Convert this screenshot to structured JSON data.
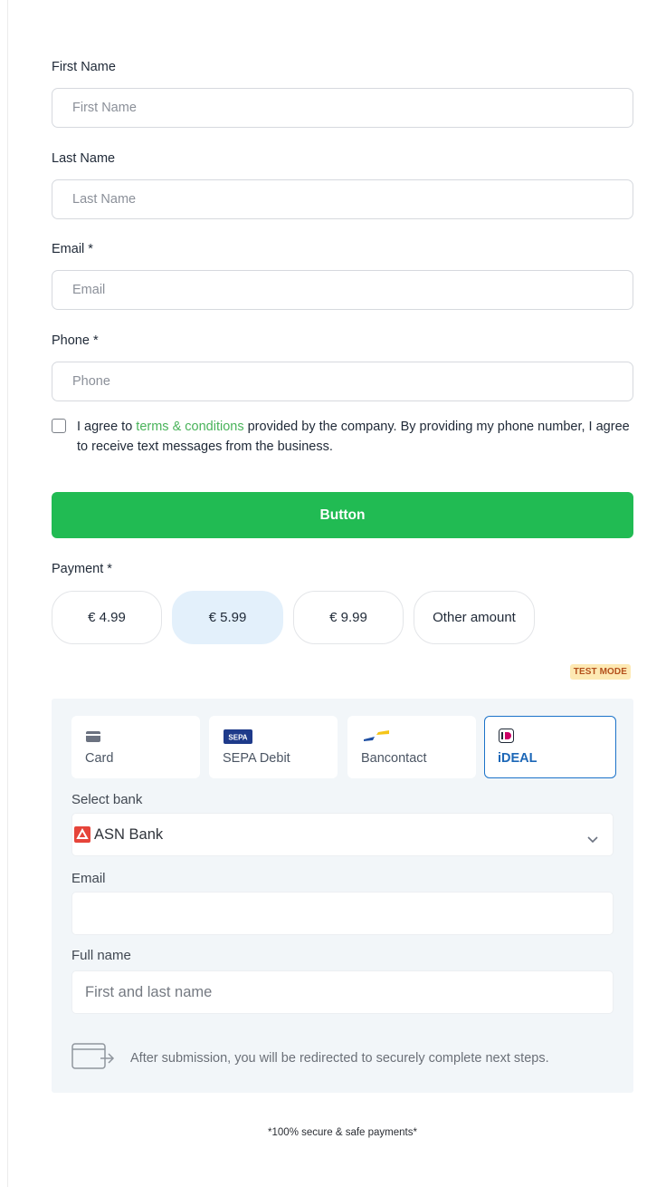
{
  "form": {
    "first_name": {
      "label": "First Name",
      "placeholder": "First Name"
    },
    "last_name": {
      "label": "Last Name",
      "placeholder": "Last Name"
    },
    "email": {
      "label": "Email *",
      "placeholder": "Email"
    },
    "phone": {
      "label": "Phone *",
      "placeholder": "Phone"
    },
    "agree": {
      "prefix": "I agree to ",
      "link": "terms & conditions",
      "suffix": " provided by the company. By providing my phone number, I agree to receive text messages from the business.",
      "checked": false
    },
    "submit_label": "Button"
  },
  "payment": {
    "label": "Payment *",
    "amounts": [
      "€ 4.99",
      "€ 5.99",
      "€ 9.99",
      "Other amount"
    ],
    "selected": "€ 5.99",
    "test_mode": "TEST MODE"
  },
  "stripe": {
    "tabs": [
      {
        "label": "Card",
        "icon": "card-icon"
      },
      {
        "label": "SEPA Debit",
        "icon": "sepa-icon",
        "badge": "SEPA"
      },
      {
        "label": "Bancontact",
        "icon": "bancontact-icon"
      },
      {
        "label": "iDEAL",
        "icon": "ideal-icon",
        "active": true
      }
    ],
    "select_bank": {
      "label": "Select bank",
      "value": "ASN Bank",
      "icon": "asn-bank-icon"
    },
    "email": {
      "label": "Email",
      "value": ""
    },
    "full_name": {
      "label": "Full name",
      "placeholder": "First and last name"
    },
    "redirect_note": "After submission, you will be redirected to securely complete next steps."
  },
  "footer": {
    "secure_note": "*100% secure & safe payments*"
  },
  "colors": {
    "primary_green": "#21bb53",
    "link_green": "#49b35a",
    "selected_amount": "#e3f0fb",
    "active_tab": "#1c73c9",
    "test_mode_bg": "#fde9b3",
    "test_mode_text": "#b4501c"
  }
}
